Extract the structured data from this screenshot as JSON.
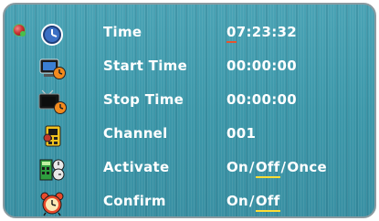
{
  "menu": {
    "rows": [
      {
        "label": "Time",
        "value": "07:23:32",
        "icon": "clock-icon"
      },
      {
        "label": "Start Time",
        "value": "00:00:00",
        "icon": "tv-clock-start-icon"
      },
      {
        "label": "Stop Time",
        "value": "00:00:00",
        "icon": "tv-clock-stop-icon"
      },
      {
        "label": "Channel",
        "value": "001",
        "icon": "channel-icon"
      },
      {
        "label": "Activate",
        "icon": "activate-icon",
        "options": [
          "On",
          "Off",
          "Once"
        ],
        "selected": "Off"
      },
      {
        "label": "Confirm",
        "icon": "alarm-clock-icon",
        "options": [
          "On",
          "Off"
        ],
        "selected": "Off"
      }
    ],
    "time_first_digit": "0",
    "time_rest": "7:23:32",
    "separator": "/"
  },
  "colors": {
    "background": "#4aa3b5",
    "text": "#ffffff",
    "cursor_underline": "#e8542e",
    "selected_underline": "#ffdd33"
  }
}
